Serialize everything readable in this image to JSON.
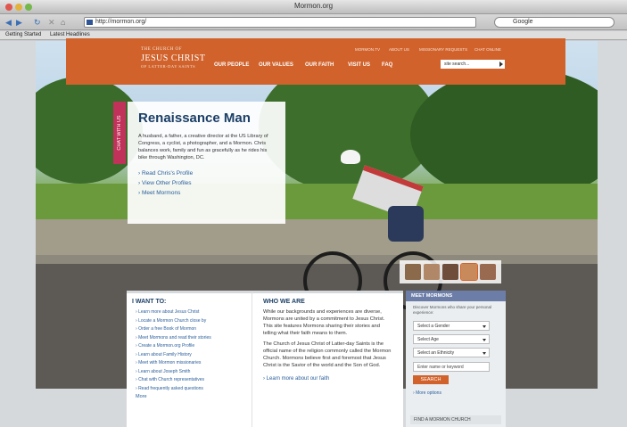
{
  "window": {
    "title": "Mormon.org"
  },
  "toolbar": {
    "url": "http://mormon.org/",
    "search_engine": "Google"
  },
  "bookmarks": [
    "Getting Started",
    "Latest Headlines"
  ],
  "header": {
    "logo_small": "THE CHURCH OF",
    "logo_big": "JESUS CHRIST",
    "logo_sub": "OF LATTER-DAY SAINTS",
    "top_links": [
      "MORMON.TV",
      "ABOUT US",
      "MISSIONARY REQUESTS",
      "CHAT ONLINE"
    ],
    "nav": [
      "OUR PEOPLE",
      "OUR VALUES",
      "OUR FAITH",
      "VISIT US",
      "FAQ"
    ],
    "search_placeholder": "site search..."
  },
  "chat_tab": "CHAT WITH US",
  "feature": {
    "title": "Renaissance Man",
    "body": "A husband, a father, a creative director at the US Library of Congress, a cyclist, a photographer, and a Mormon. Chris balances work, family and fun as gracefully as he rides his bike through Washington, DC.",
    "links": [
      "Read Chris's Profile",
      "View Other Profiles",
      "Meet Mormons"
    ]
  },
  "want": {
    "title": "I WANT TO:",
    "items": [
      "Learn more about Jesus Christ",
      "Locate a Mormon Church close by",
      "Order a free Book of Mormon",
      "Meet Mormons and read their stories",
      "Create a Mormon.org Profile",
      "Learn about Family History",
      "Meet with Mormon missionaries",
      "Learn about Joseph Smith",
      "Chat with Church representatives",
      "Read frequently asked questions"
    ],
    "more": "More"
  },
  "who": {
    "title": "WHO WE ARE",
    "p1": "While our backgrounds and experiences are diverse, Mormons are united by a commitment to Jesus Christ. This site features Mormons sharing their stories and telling what their faith means to them.",
    "p2": "The Church of Jesus Christ of Latter-day Saints is the official name of the religion commonly called the Mormon Church. Mormons believe first and foremost that Jesus Christ is the Savior of the world and the Son of God.",
    "link": "Learn more about our faith"
  },
  "meet": {
    "title": "MEET MORMONS",
    "desc": "Discover Mormons who share your personal experience:",
    "selects": [
      "Select a Gender",
      "Select Age",
      "Select an Ethnicity"
    ],
    "keyword": "Enter name or keyword",
    "button": "SEARCH",
    "more": "More options",
    "find": "FIND A MORMON CHURCH"
  },
  "colors": {
    "brand": "#d1622b",
    "link": "#2a5e9c",
    "chat": "#c0325a"
  }
}
